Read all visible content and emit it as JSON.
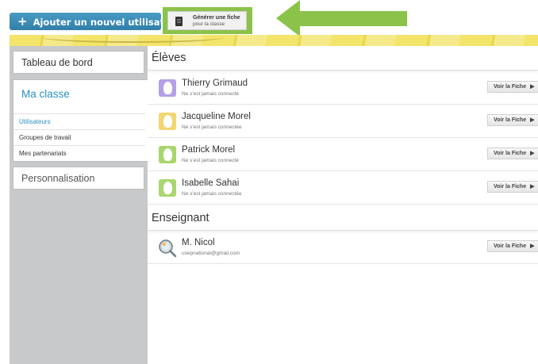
{
  "toolbar": {
    "add_user_label": "Ajouter un nouvel utilisateur",
    "generate_line1": "Générer une fiche",
    "generate_line2": "pour la classe"
  },
  "sidebar": {
    "dashboard": "Tableau de bord",
    "my_class": "Ma classe",
    "class_items": [
      {
        "label": "Utilisateurs",
        "active": true
      },
      {
        "label": "Groupes de travail",
        "active": false
      },
      {
        "label": "Mes partenariats",
        "active": false
      }
    ],
    "personalization": "Personnalisation"
  },
  "main": {
    "students_title": "Élèves",
    "students": [
      {
        "name": "Thierry Grimaud",
        "status": "Ne s'est jamais connecté",
        "avatar_color": "#b5a0e6",
        "button": "Voir la Fiche"
      },
      {
        "name": "Jacqueline Morel",
        "status": "Ne s'est jamais connectée",
        "avatar_color": "#f2d670",
        "button": "Voir la Fiche"
      },
      {
        "name": "Patrick Morel",
        "status": "Ne s'est jamais connecté",
        "avatar_color": "#a9d66e",
        "button": "Voir la Fiche"
      },
      {
        "name": "Isabelle Sahai",
        "status": "Ne s'est jamais connectée",
        "avatar_color": "#a9d66e",
        "button": "Voir la Fiche"
      }
    ],
    "teachers_title": "Enseignant",
    "teachers": [
      {
        "name": "M. Nicol",
        "email": "usepnational@gmail.com",
        "button": "Voir la Fiche"
      }
    ]
  },
  "colors": {
    "accent_blue": "#2a90c0",
    "highlight_green": "#8bc34a",
    "sidebar_gray": "#c8c9cb"
  },
  "icons": {
    "add": "plus-icon",
    "generate": "document-icon",
    "arrow": "arrow-left-icon",
    "row_action": "triangle-right-icon"
  }
}
